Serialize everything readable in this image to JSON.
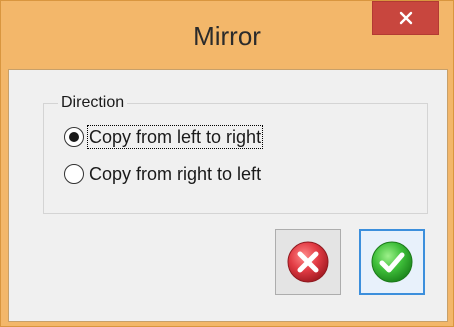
{
  "window": {
    "title": "Mirror",
    "close_icon": "close-icon"
  },
  "direction": {
    "group_label": "Direction",
    "options": [
      {
        "label": "Copy from left to right",
        "selected": true
      },
      {
        "label": "Copy from right to left",
        "selected": false
      }
    ]
  },
  "buttons": {
    "cancel_icon": "cancel-x-icon",
    "ok_icon": "ok-check-icon"
  },
  "colors": {
    "frame": "#f3b76a",
    "close_button": "#c8463e",
    "cancel_red": "#d9363e",
    "ok_green": "#3fbf3a",
    "ok_border": "#3c8fdc"
  }
}
